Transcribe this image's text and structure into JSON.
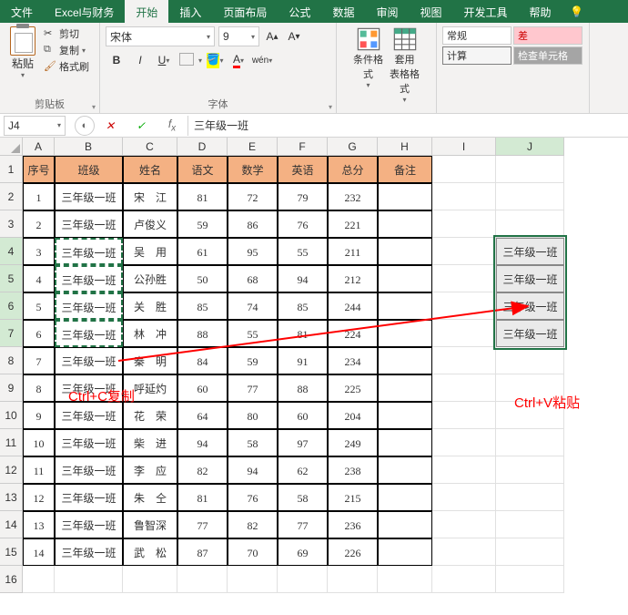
{
  "tabs": {
    "file": "文件",
    "custom": "Excel与财务",
    "home": "开始",
    "insert": "插入",
    "layout": "页面布局",
    "formula": "公式",
    "data": "数据",
    "review": "审阅",
    "view": "视图",
    "dev": "开发工具",
    "help": "帮助"
  },
  "clipboard": {
    "cut": "剪切",
    "copy": "复制",
    "brush": "格式刷",
    "paste": "粘贴",
    "group": "剪贴板"
  },
  "font": {
    "name": "宋体",
    "size": "9",
    "group": "字体",
    "wen": "wén"
  },
  "cond": {
    "cond": "条件格式",
    "table": "套用\n表格格式"
  },
  "styles": {
    "normal": "常规",
    "bad": "差",
    "calc": "计算",
    "check": "检查单元格"
  },
  "namebox": "J4",
  "formula": "三年级一班",
  "headers": [
    "序号",
    "班级",
    "姓名",
    "语文",
    "数学",
    "英语",
    "总分",
    "备注"
  ],
  "rows": [
    {
      "n": "1",
      "cls": "三年级一班",
      "name": "宋　江",
      "c": "81",
      "m": "72",
      "e": "79",
      "t": "232"
    },
    {
      "n": "2",
      "cls": "三年级一班",
      "name": "卢俊义",
      "c": "59",
      "m": "86",
      "e": "76",
      "t": "221"
    },
    {
      "n": "3",
      "cls": "三年级一班",
      "name": "吴　用",
      "c": "61",
      "m": "95",
      "e": "55",
      "t": "211"
    },
    {
      "n": "4",
      "cls": "三年级一班",
      "name": "公孙胜",
      "c": "50",
      "m": "68",
      "e": "94",
      "t": "212"
    },
    {
      "n": "5",
      "cls": "三年级一班",
      "name": "关　胜",
      "c": "85",
      "m": "74",
      "e": "85",
      "t": "244"
    },
    {
      "n": "6",
      "cls": "三年级一班",
      "name": "林　冲",
      "c": "88",
      "m": "55",
      "e": "81",
      "t": "224"
    },
    {
      "n": "7",
      "cls": "三年级一班",
      "name": "秦　明",
      "c": "84",
      "m": "59",
      "e": "91",
      "t": "234"
    },
    {
      "n": "8",
      "cls": "三年级一班",
      "name": "呼延灼",
      "c": "60",
      "m": "77",
      "e": "88",
      "t": "225"
    },
    {
      "n": "9",
      "cls": "三年级一班",
      "name": "花　荣",
      "c": "64",
      "m": "80",
      "e": "60",
      "t": "204"
    },
    {
      "n": "10",
      "cls": "三年级一班",
      "name": "柴　进",
      "c": "94",
      "m": "58",
      "e": "97",
      "t": "249"
    },
    {
      "n": "11",
      "cls": "三年级一班",
      "name": "李　应",
      "c": "82",
      "m": "94",
      "e": "62",
      "t": "238"
    },
    {
      "n": "12",
      "cls": "三年级一班",
      "name": "朱　仝",
      "c": "81",
      "m": "76",
      "e": "58",
      "t": "215"
    },
    {
      "n": "13",
      "cls": "三年级一班",
      "name": "鲁智深",
      "c": "77",
      "m": "82",
      "e": "77",
      "t": "236"
    },
    {
      "n": "14",
      "cls": "三年级一班",
      "name": "武　松",
      "c": "87",
      "m": "70",
      "e": "69",
      "t": "226"
    }
  ],
  "paste_dest": [
    "三年级一班",
    "三年级一班",
    "三年级一班",
    "三年级一班"
  ],
  "anno_copy": "Ctrl+C复制",
  "anno_paste": "Ctrl+V粘贴"
}
